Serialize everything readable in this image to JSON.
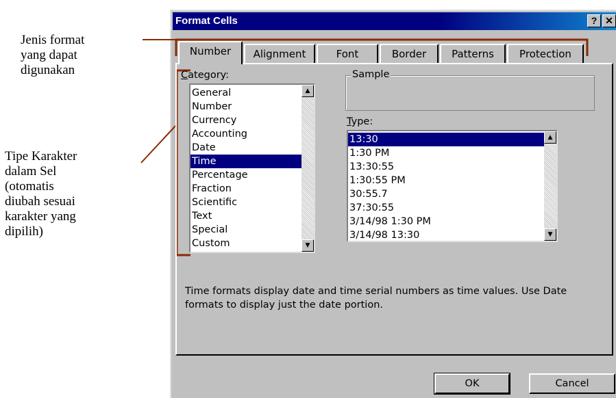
{
  "annotations": {
    "format_types": [
      "Jenis format",
      "yang dapat",
      "digunakan"
    ],
    "char_type": [
      "Tipe Karakter",
      "dalam Sel",
      "(otomatis",
      "diubah sesuai",
      "karakter yang",
      "dipilih)"
    ]
  },
  "dialog": {
    "title": "Format Cells",
    "help_glyph": "?",
    "close_glyph": "✕",
    "tabs": [
      "Number",
      "Alignment",
      "Font",
      "Border",
      "Patterns",
      "Protection"
    ],
    "active_tab": "Number",
    "category_label_first": "C",
    "category_label_rest": "ategory:",
    "categories": [
      "General",
      "Number",
      "Currency",
      "Accounting",
      "Date",
      "Time",
      "Percentage",
      "Fraction",
      "Scientific",
      "Text",
      "Special",
      "Custom"
    ],
    "selected_category": "Time",
    "sample_label": "Sample",
    "type_label_first": "T",
    "type_label_rest": "ype:",
    "types": [
      "13:30",
      "1:30 PM",
      "13:30:55",
      "1:30:55 PM",
      "30:55.7",
      "37:30:55",
      "3/14/98 1:30 PM",
      "3/14/98 13:30"
    ],
    "selected_type": "13:30",
    "description_line1": "Time formats display date and time serial numbers as time values.  Use Date",
    "description_line2": "formats to display just the date portion.",
    "ok_label": "OK",
    "cancel_label": "Cancel",
    "scroll_up_glyph": "▲",
    "scroll_down_glyph": "▼"
  },
  "colors": {
    "title_bar": "#000080",
    "selection": "#000080",
    "annotation_line": "#8b2a00",
    "dialog_face": "#c0c0c0"
  }
}
